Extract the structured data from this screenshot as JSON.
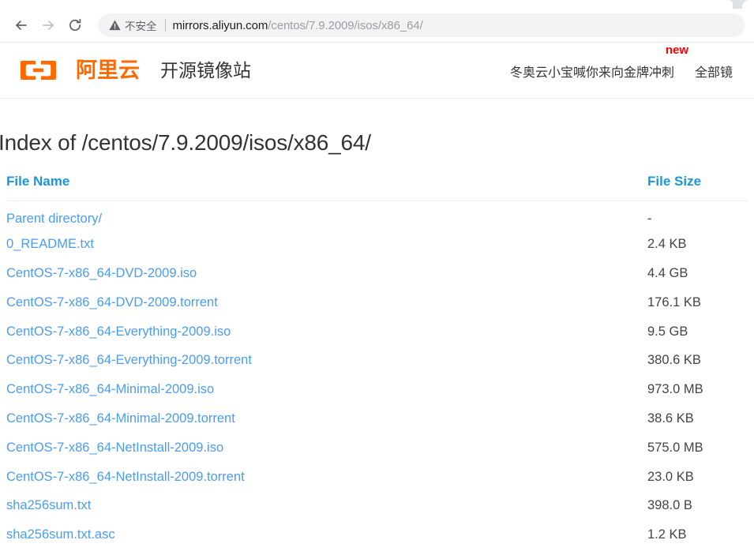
{
  "browser": {
    "back_icon": "back-arrow-icon",
    "forward_icon": "forward-arrow-icon",
    "reload_icon": "reload-icon",
    "security_icon": "warning-triangle-icon",
    "security_label": "不安全",
    "url_host": "mirrors.aliyun.com",
    "url_path": "/centos/7.9.2009/isos/x86_64/",
    "url_full": "mirrors.aliyun.com/centos/7.9.2009/isos/x86_64/"
  },
  "site_header": {
    "logo_icon": "aliyun-logo-icon",
    "brand_name": "阿里云",
    "site_title": "开源镜像站",
    "nav": [
      {
        "label": "冬奥云小宝喊你来向金牌冲刺",
        "badge": "new"
      },
      {
        "label": "全部镜",
        "badge": ""
      }
    ]
  },
  "page": {
    "title": "Index of /centos/7.9.2009/isos/x86_64/",
    "columns": {
      "name": "File Name",
      "size": "File Size"
    },
    "rows": [
      {
        "name": "Parent directory/",
        "size": "-"
      },
      {
        "name": "0_README.txt",
        "size": "2.4 KB"
      },
      {
        "name": "CentOS-7-x86_64-DVD-2009.iso",
        "size": "4.4 GB"
      },
      {
        "name": "CentOS-7-x86_64-DVD-2009.torrent",
        "size": "176.1 KB"
      },
      {
        "name": "CentOS-7-x86_64-Everything-2009.iso",
        "size": "9.5 GB"
      },
      {
        "name": "CentOS-7-x86_64-Everything-2009.torrent",
        "size": "380.6 KB"
      },
      {
        "name": "CentOS-7-x86_64-Minimal-2009.iso",
        "size": "973.0 MB"
      },
      {
        "name": "CentOS-7-x86_64-Minimal-2009.torrent",
        "size": "38.6 KB"
      },
      {
        "name": "CentOS-7-x86_64-NetInstall-2009.iso",
        "size": "575.0 MB"
      },
      {
        "name": "CentOS-7-x86_64-NetInstall-2009.torrent",
        "size": "23.0 KB"
      },
      {
        "name": "sha256sum.txt",
        "size": "398.0 B"
      },
      {
        "name": "sha256sum.txt.asc",
        "size": "1.2 KB"
      }
    ]
  },
  "colors": {
    "brand_orange": "#ff6a00",
    "link_blue": "#4a9cf2",
    "header_blue": "#1b96dd",
    "badge_red": "#ff0000",
    "chrome_gray": "#dee1e6",
    "omnibox_gray": "#f1f3f4"
  }
}
